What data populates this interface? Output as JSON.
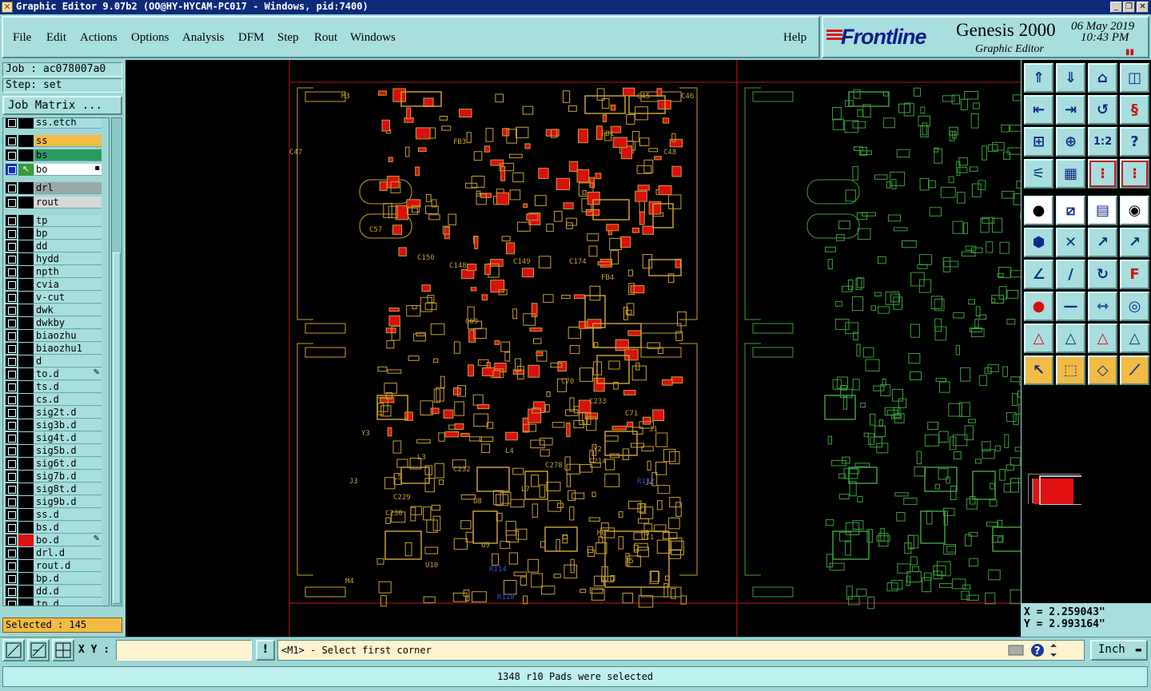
{
  "window": {
    "title": "Graphic Editor 9.07b2 (OO@HY-HYCAM-PC017 - Windows, pid:7400)",
    "controls": [
      "_",
      "❐",
      "✕"
    ]
  },
  "menu": [
    "File",
    "Edit",
    "Actions",
    "Options",
    "Analysis",
    "DFM",
    "Step",
    "Rout",
    "Windows"
  ],
  "help_label": "Help",
  "brand": {
    "logo": "Frontline",
    "product": "Genesis 2000",
    "subtitle": "Graphic Editor",
    "date": "06 May 2019",
    "time": "10:43 PM"
  },
  "job": {
    "label": "Job : ac078007a0",
    "step": "Step: set",
    "matrix_button": "Job Matrix ..."
  },
  "layers": [
    {
      "name": "ss.etch",
      "color": "#000000",
      "nameBg": "#a8dede"
    },
    {
      "name": "ss",
      "color": "#000000",
      "nameBg": "#f2bb45"
    },
    {
      "name": "bs",
      "color": "#000000",
      "nameBg": "#2a9a60"
    },
    {
      "name": "bo",
      "color": "#3a9a3a",
      "nameBg": "#ffffff",
      "active": true
    },
    {
      "name": "drl",
      "color": "#000000",
      "nameBg": "#9aa8a8"
    },
    {
      "name": "rout",
      "color": "#000000",
      "nameBg": "#d8d8d8"
    },
    {
      "name": "tp",
      "color": "#000000",
      "nameBg": "#a8dede"
    },
    {
      "name": "bp",
      "color": "#000000",
      "nameBg": "#a8dede"
    },
    {
      "name": "dd",
      "color": "#000000",
      "nameBg": "#a8dede"
    },
    {
      "name": "hydd",
      "color": "#000000",
      "nameBg": "#a8dede"
    },
    {
      "name": "npth",
      "color": "#000000",
      "nameBg": "#a8dede"
    },
    {
      "name": "cvia",
      "color": "#000000",
      "nameBg": "#a8dede"
    },
    {
      "name": "v-cut",
      "color": "#000000",
      "nameBg": "#a8dede"
    },
    {
      "name": "dwk",
      "color": "#000000",
      "nameBg": "#a8dede"
    },
    {
      "name": "dwkby",
      "color": "#000000",
      "nameBg": "#a8dede"
    },
    {
      "name": "biaozhu",
      "color": "#000000",
      "nameBg": "#a8dede"
    },
    {
      "name": "biaozhu1",
      "color": "#000000",
      "nameBg": "#a8dede"
    },
    {
      "name": "d",
      "color": "#000000",
      "nameBg": "#a8dede"
    },
    {
      "name": "to.d",
      "color": "#000000",
      "nameBg": "#a8dede",
      "edit": true
    },
    {
      "name": "ts.d",
      "color": "#000000",
      "nameBg": "#a8dede"
    },
    {
      "name": "cs.d",
      "color": "#000000",
      "nameBg": "#a8dede"
    },
    {
      "name": "sig2t.d",
      "color": "#000000",
      "nameBg": "#a8dede"
    },
    {
      "name": "sig3b.d",
      "color": "#000000",
      "nameBg": "#a8dede"
    },
    {
      "name": "sig4t.d",
      "color": "#000000",
      "nameBg": "#a8dede"
    },
    {
      "name": "sig5b.d",
      "color": "#000000",
      "nameBg": "#a8dede"
    },
    {
      "name": "sig6t.d",
      "color": "#000000",
      "nameBg": "#a8dede"
    },
    {
      "name": "sig7b.d",
      "color": "#000000",
      "nameBg": "#a8dede"
    },
    {
      "name": "sig8t.d",
      "color": "#000000",
      "nameBg": "#a8dede"
    },
    {
      "name": "sig9b.d",
      "color": "#000000",
      "nameBg": "#a8dede"
    },
    {
      "name": "ss.d",
      "color": "#000000",
      "nameBg": "#a8dede"
    },
    {
      "name": "bs.d",
      "color": "#000000",
      "nameBg": "#a8dede"
    },
    {
      "name": "bo.d",
      "color": "#e01010",
      "nameBg": "#a8dede",
      "edit": true
    },
    {
      "name": "drl.d",
      "color": "#000000",
      "nameBg": "#a8dede"
    },
    {
      "name": "rout.d",
      "color": "#000000",
      "nameBg": "#a8dede"
    },
    {
      "name": "bp.d",
      "color": "#000000",
      "nameBg": "#a8dede"
    },
    {
      "name": "dd.d",
      "color": "#000000",
      "nameBg": "#a8dede"
    },
    {
      "name": "tp.d",
      "color": "#000000",
      "nameBg": "#a8dede"
    }
  ],
  "selected": "Selected : 145",
  "labels": [
    "C45",
    "C46",
    "C47",
    "C48",
    "C57",
    "C69",
    "C70",
    "C71",
    "FB1",
    "FB3",
    "FB4",
    "L3",
    "L4",
    "L5",
    "L7",
    "J3",
    "J4",
    "J5",
    "J1",
    "U8",
    "U9",
    "U10",
    "U11",
    "Y2",
    "Y3",
    "R114",
    "R118",
    "R122",
    "M3",
    "M4",
    "M5",
    "M6",
    "C150",
    "C149",
    "C148",
    "C174",
    "C229",
    "C230",
    "C232",
    "C233",
    "C278",
    "C214"
  ],
  "coords": {
    "x": "X = 2.259043\"",
    "y": "Y = 2.993164\""
  },
  "input": {
    "xy_label": "X Y :",
    "xy_value": "",
    "bang": "!"
  },
  "prompt": "<M1> - Select first corner",
  "unit": "Inch",
  "status": "1348 r10 Pads were selected",
  "colors": {
    "panel": "#a8dede",
    "highlight": "#f2bb45",
    "selection": "#e01010",
    "layer_active": "#c8a030",
    "layer_ref": "#3aa03a",
    "title": "#0c2a7a"
  }
}
